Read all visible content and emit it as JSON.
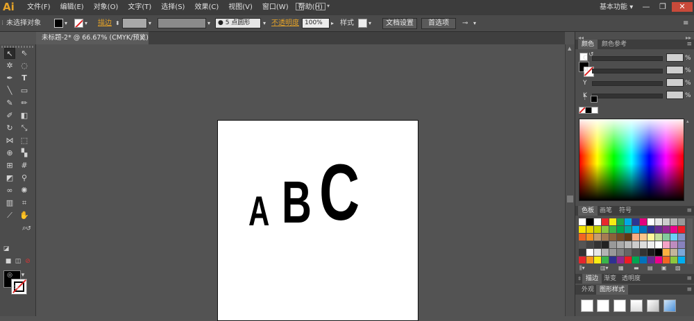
{
  "app": {
    "logo": "Ai"
  },
  "menu": {
    "items": [
      "文件(F)",
      "编辑(E)",
      "对象(O)",
      "文字(T)",
      "选择(S)",
      "效果(C)",
      "视图(V)",
      "窗口(W)",
      "帮助(H)"
    ]
  },
  "workspace": {
    "label": "基本功能",
    "arrow": "▾"
  },
  "window_controls": {
    "minimize": "—",
    "restore": "❐",
    "close": "✕"
  },
  "control_bar": {
    "selection_label": "未选择对象",
    "stroke_label": "描边",
    "stroke_weight_value": "",
    "brush_value": "5 点圆形",
    "opacity_label": "不透明度",
    "opacity_value": "100%",
    "style_label": "样式",
    "doc_setup_button": "文档设置",
    "preferences_button": "首选项"
  },
  "document_tab": {
    "title": "未标题-2* @ 66.67% (CMYK/预览)",
    "close": "×"
  },
  "artboard": {
    "letters": [
      "A",
      "B",
      "C"
    ]
  },
  "color_panel": {
    "tabs": [
      "颜色",
      "颜色参考"
    ],
    "channels": [
      {
        "label": "C",
        "value": "",
        "unit": "%"
      },
      {
        "label": "M",
        "value": "",
        "unit": "%"
      },
      {
        "label": "Y",
        "value": "",
        "unit": "%"
      },
      {
        "label": "K",
        "value": "",
        "unit": "%"
      }
    ]
  },
  "swatches_panel": {
    "tabs": [
      "色板",
      "画笔",
      "符号"
    ]
  },
  "stroke_panel": {
    "tabs": [
      "描边",
      "渐变",
      "透明度"
    ]
  },
  "appearance_panel": {
    "tabs": [
      "外观",
      "图形样式"
    ]
  },
  "colors": {
    "swatches": [
      "#ffffff",
      "#000000",
      "#ffffff",
      "#e7262d",
      "#f7ec13",
      "#22a146",
      "#00a9e5",
      "#2c3593",
      "#e4007e",
      "#ffffff",
      "#e6e6e6",
      "#cccccc",
      "#b3b3b3",
      "#999999",
      "#f6e500",
      "#e9d500",
      "#c7d300",
      "#8cc63f",
      "#3ab54a",
      "#00a651",
      "#00a99d",
      "#00aeef",
      "#0072bc",
      "#2e3192",
      "#662d91",
      "#92278f",
      "#ec008c",
      "#ed1c24",
      "#f26522",
      "#f7941d",
      "#c69c6d",
      "#a67c52",
      "#8c6239",
      "#754c24",
      "#603913",
      "#f9ad81",
      "#fdc68a",
      "#fff799",
      "#c4df9b",
      "#82ca9c",
      "#6dcff6",
      "#8393ca",
      "#555555",
      "#444444",
      "#333333",
      "#222222",
      "#999999",
      "#aaaaaa",
      "#bbbbbb",
      "#cccccc",
      "#dddddd",
      "#eeeeee",
      "#ffffff",
      "#f5a3c7",
      "#bd8cbf",
      "#8781bd",
      "#333333",
      "#ffffff",
      "#e6e6e6",
      "#b3b3b3",
      "#999999",
      "#808080",
      "#666666",
      "#4d4d4d",
      "#333333",
      "#1a1a1a",
      "#000000",
      "#fbb040",
      "#c2b59b",
      "#7da7d9",
      "#e7262d",
      "#f7941d",
      "#f7ec13",
      "#39b54a",
      "#2e3192",
      "#92278f",
      "#ed1c24",
      "#00a651",
      "#0072bc",
      "#662d91",
      "#ec008c",
      "#f26522",
      "#8cc63f",
      "#00aeef"
    ]
  }
}
